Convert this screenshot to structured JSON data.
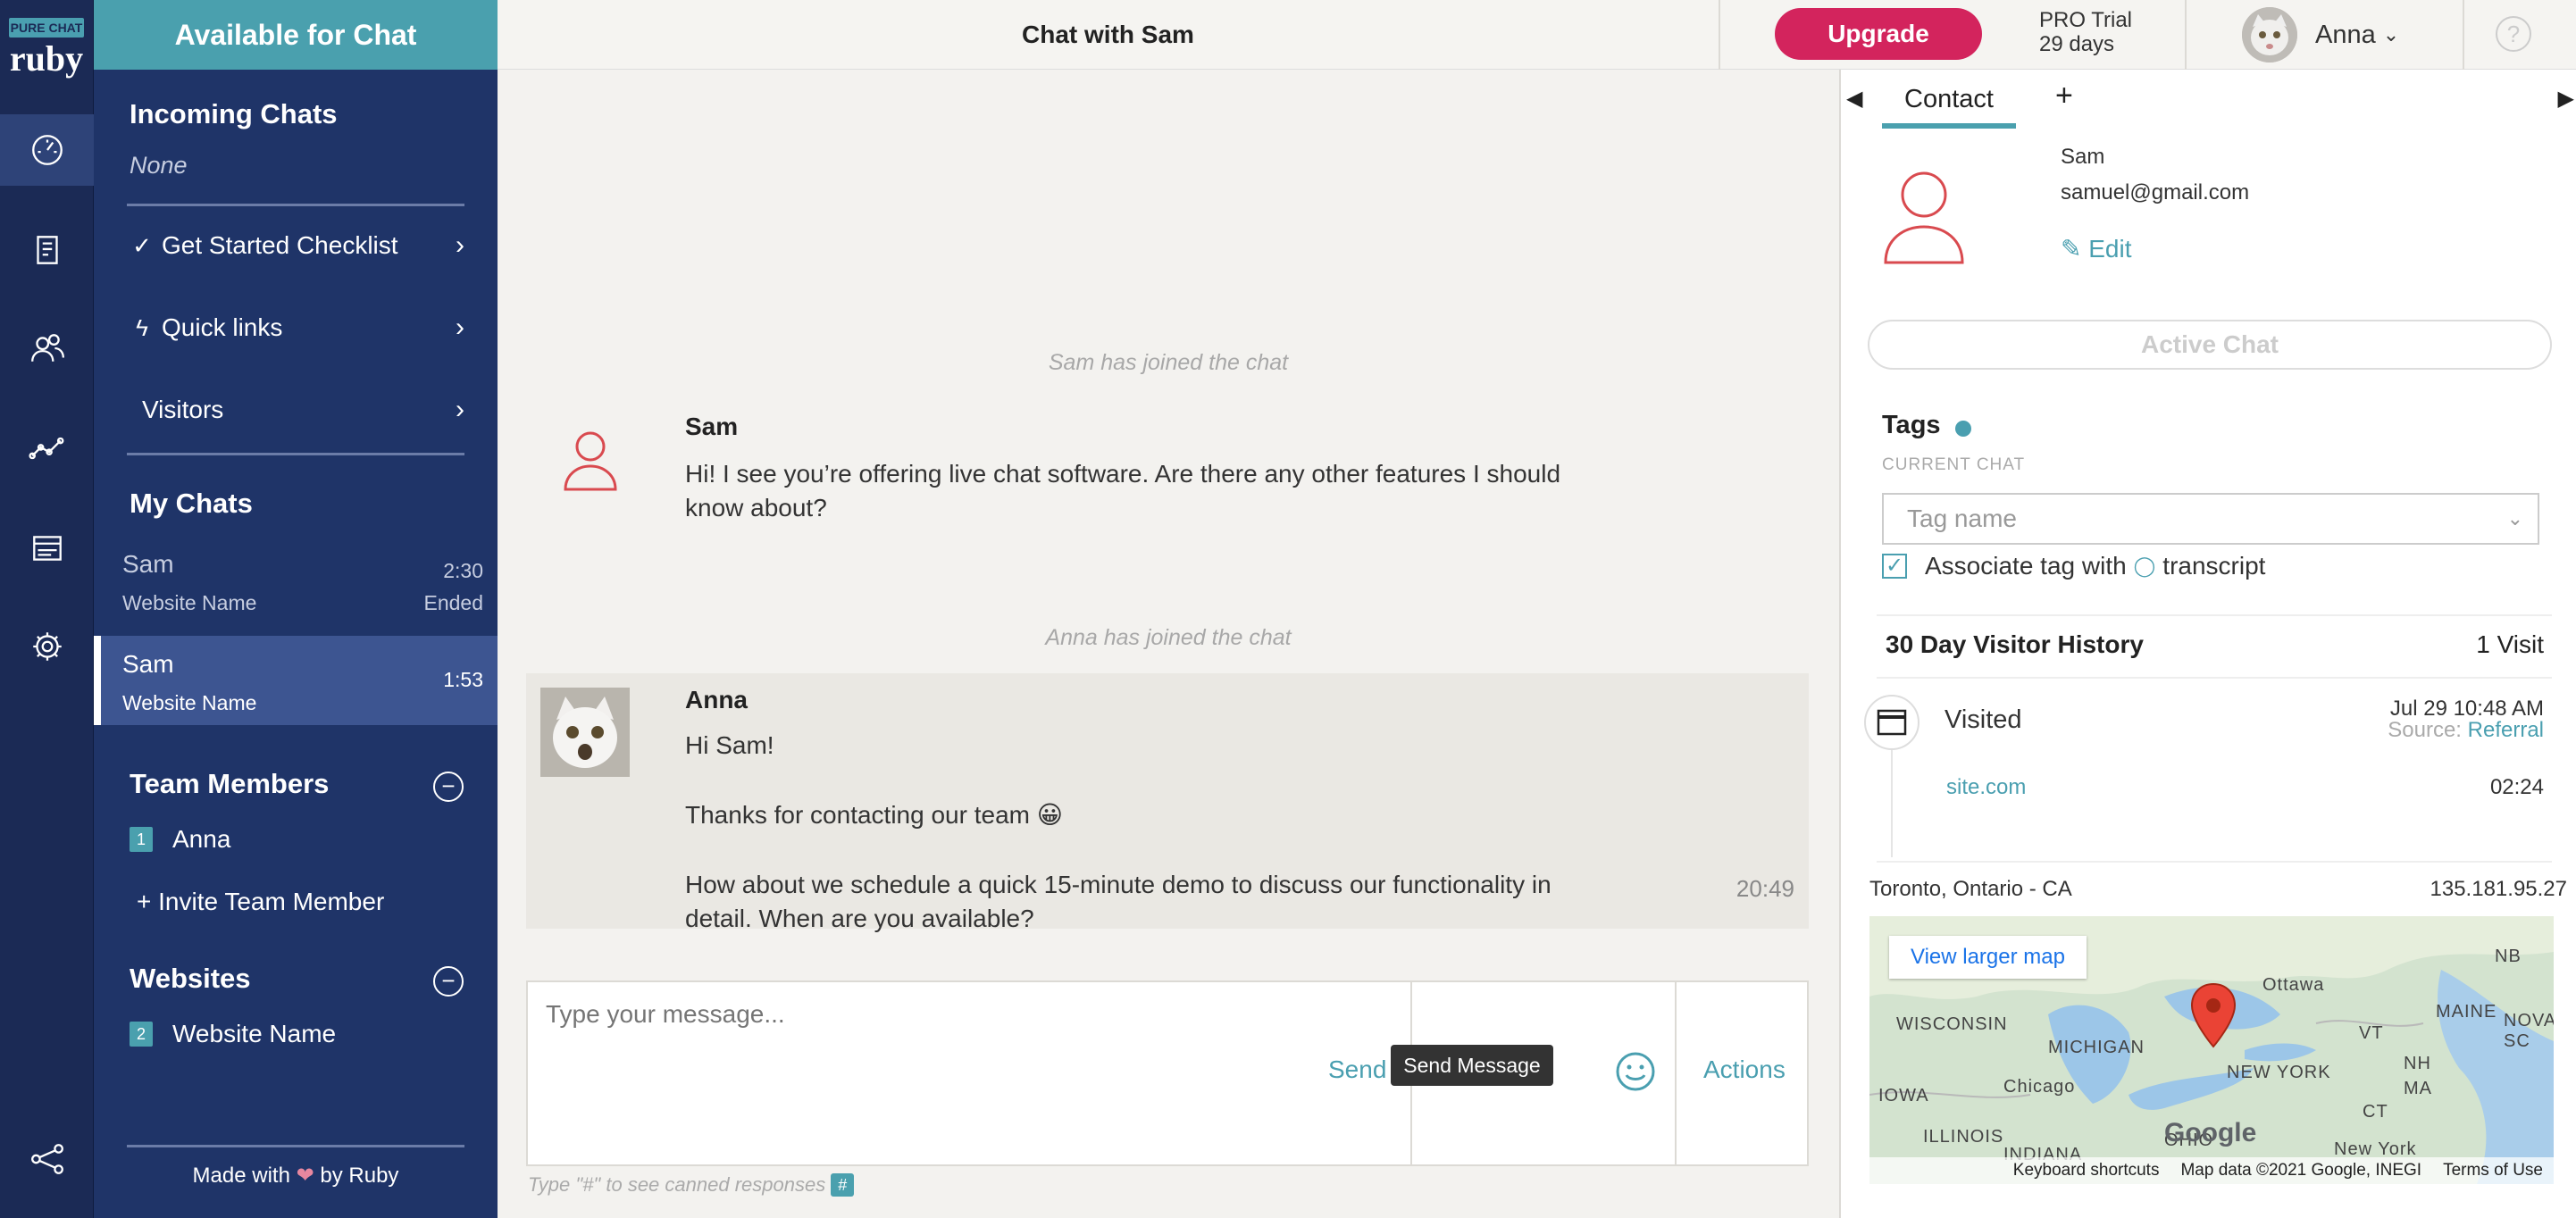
{
  "logo": {
    "top": "PURE CHAT",
    "bottom": "ruby"
  },
  "sidebar": {
    "status": "Available for Chat",
    "incoming_title": "Incoming Chats",
    "incoming_value": "None",
    "nav": {
      "checklist": "Get Started Checklist",
      "quick_links": "Quick links",
      "visitors": "Visitors"
    },
    "my_chats_title": "My Chats",
    "chats": [
      {
        "name": "Sam",
        "website": "Website Name",
        "time": "2:30",
        "status": "Ended"
      },
      {
        "name": "Sam",
        "website": "Website Name",
        "time": "1:53"
      }
    ],
    "team_title": "Team Members",
    "team_members": [
      {
        "num": "1",
        "name": "Anna"
      }
    ],
    "invite": "+ Invite Team Member",
    "websites_title": "Websites",
    "websites": [
      {
        "num": "2",
        "name": "Website Name"
      }
    ],
    "made_with_pre": "Made with",
    "made_with_post": "by Ruby"
  },
  "header": {
    "chat_title": "Chat with Sam",
    "upgrade": "Upgrade",
    "trial_line1": "PRO Trial",
    "trial_line2": "29 days",
    "user_name": "Anna",
    "help": "?"
  },
  "chat": {
    "sys_sam_joined": "Sam has joined the chat",
    "sam_name": "Sam",
    "sam_msg_1": "Hi! I see you’re offering live chat software. Are there any other features I should",
    "sam_msg_2": "know about?",
    "sys_anna_joined": "Anna has joined the chat",
    "anna_name": "Anna",
    "anna_msg_1": "Hi Sam!",
    "anna_msg_2": "Thanks for contacting our team 😀",
    "anna_msg_3a": "How about we schedule a quick 15-minute demo to discuss our functionality in",
    "anna_msg_3b": "detail. When are you available?",
    "anna_time": "20:49",
    "placeholder": "Type your message...",
    "send": "Send",
    "tooltip": "Send Message",
    "actions": "Actions",
    "canned_hint": "Type \"#\" to see canned responses",
    "canned_hash": "#"
  },
  "panel": {
    "tab_contact": "Contact",
    "tab_add": "+",
    "contact_name": "Sam",
    "contact_email": "samuel@gmail.com",
    "edit": "Edit",
    "active_chat": "Active Chat",
    "tags_title": "Tags",
    "current_chat": "CURRENT CHAT",
    "tag_placeholder": "Tag name",
    "assoc_pre": "Associate tag with",
    "assoc_post": "transcript",
    "history_title": "30 Day Visitor History",
    "history_count": "1 Visit",
    "visited": "Visited",
    "visit_date": "Jul 29 10:48 AM",
    "source_label": "Source:",
    "source_value": "Referral",
    "site": "site.com",
    "site_time": "02:24",
    "location": "Toronto, Ontario - CA",
    "ip": "135.181.95.27",
    "map": {
      "view_larger": "View larger map",
      "labels": [
        "NB",
        "Ottawa",
        "MAINE",
        "NOVA SC",
        "WISCONSIN",
        "MICHIGAN",
        "VT",
        "NH",
        "NEW YORK",
        "MA",
        "IOWA",
        "Chicago",
        "ILLINOIS",
        "OHIO",
        "CT",
        "New York",
        "INDIANA"
      ],
      "google": "Google",
      "footer": [
        "Keyboard shortcuts",
        "Map data ©2021 Google, INEGI",
        "Terms of Use"
      ]
    }
  },
  "colors": {
    "teal": "#4aa0ae",
    "navy": "#1f3468",
    "upgrade": "#d3245d",
    "link": "#4a9fb0",
    "alert_red": "#d94a4f"
  }
}
